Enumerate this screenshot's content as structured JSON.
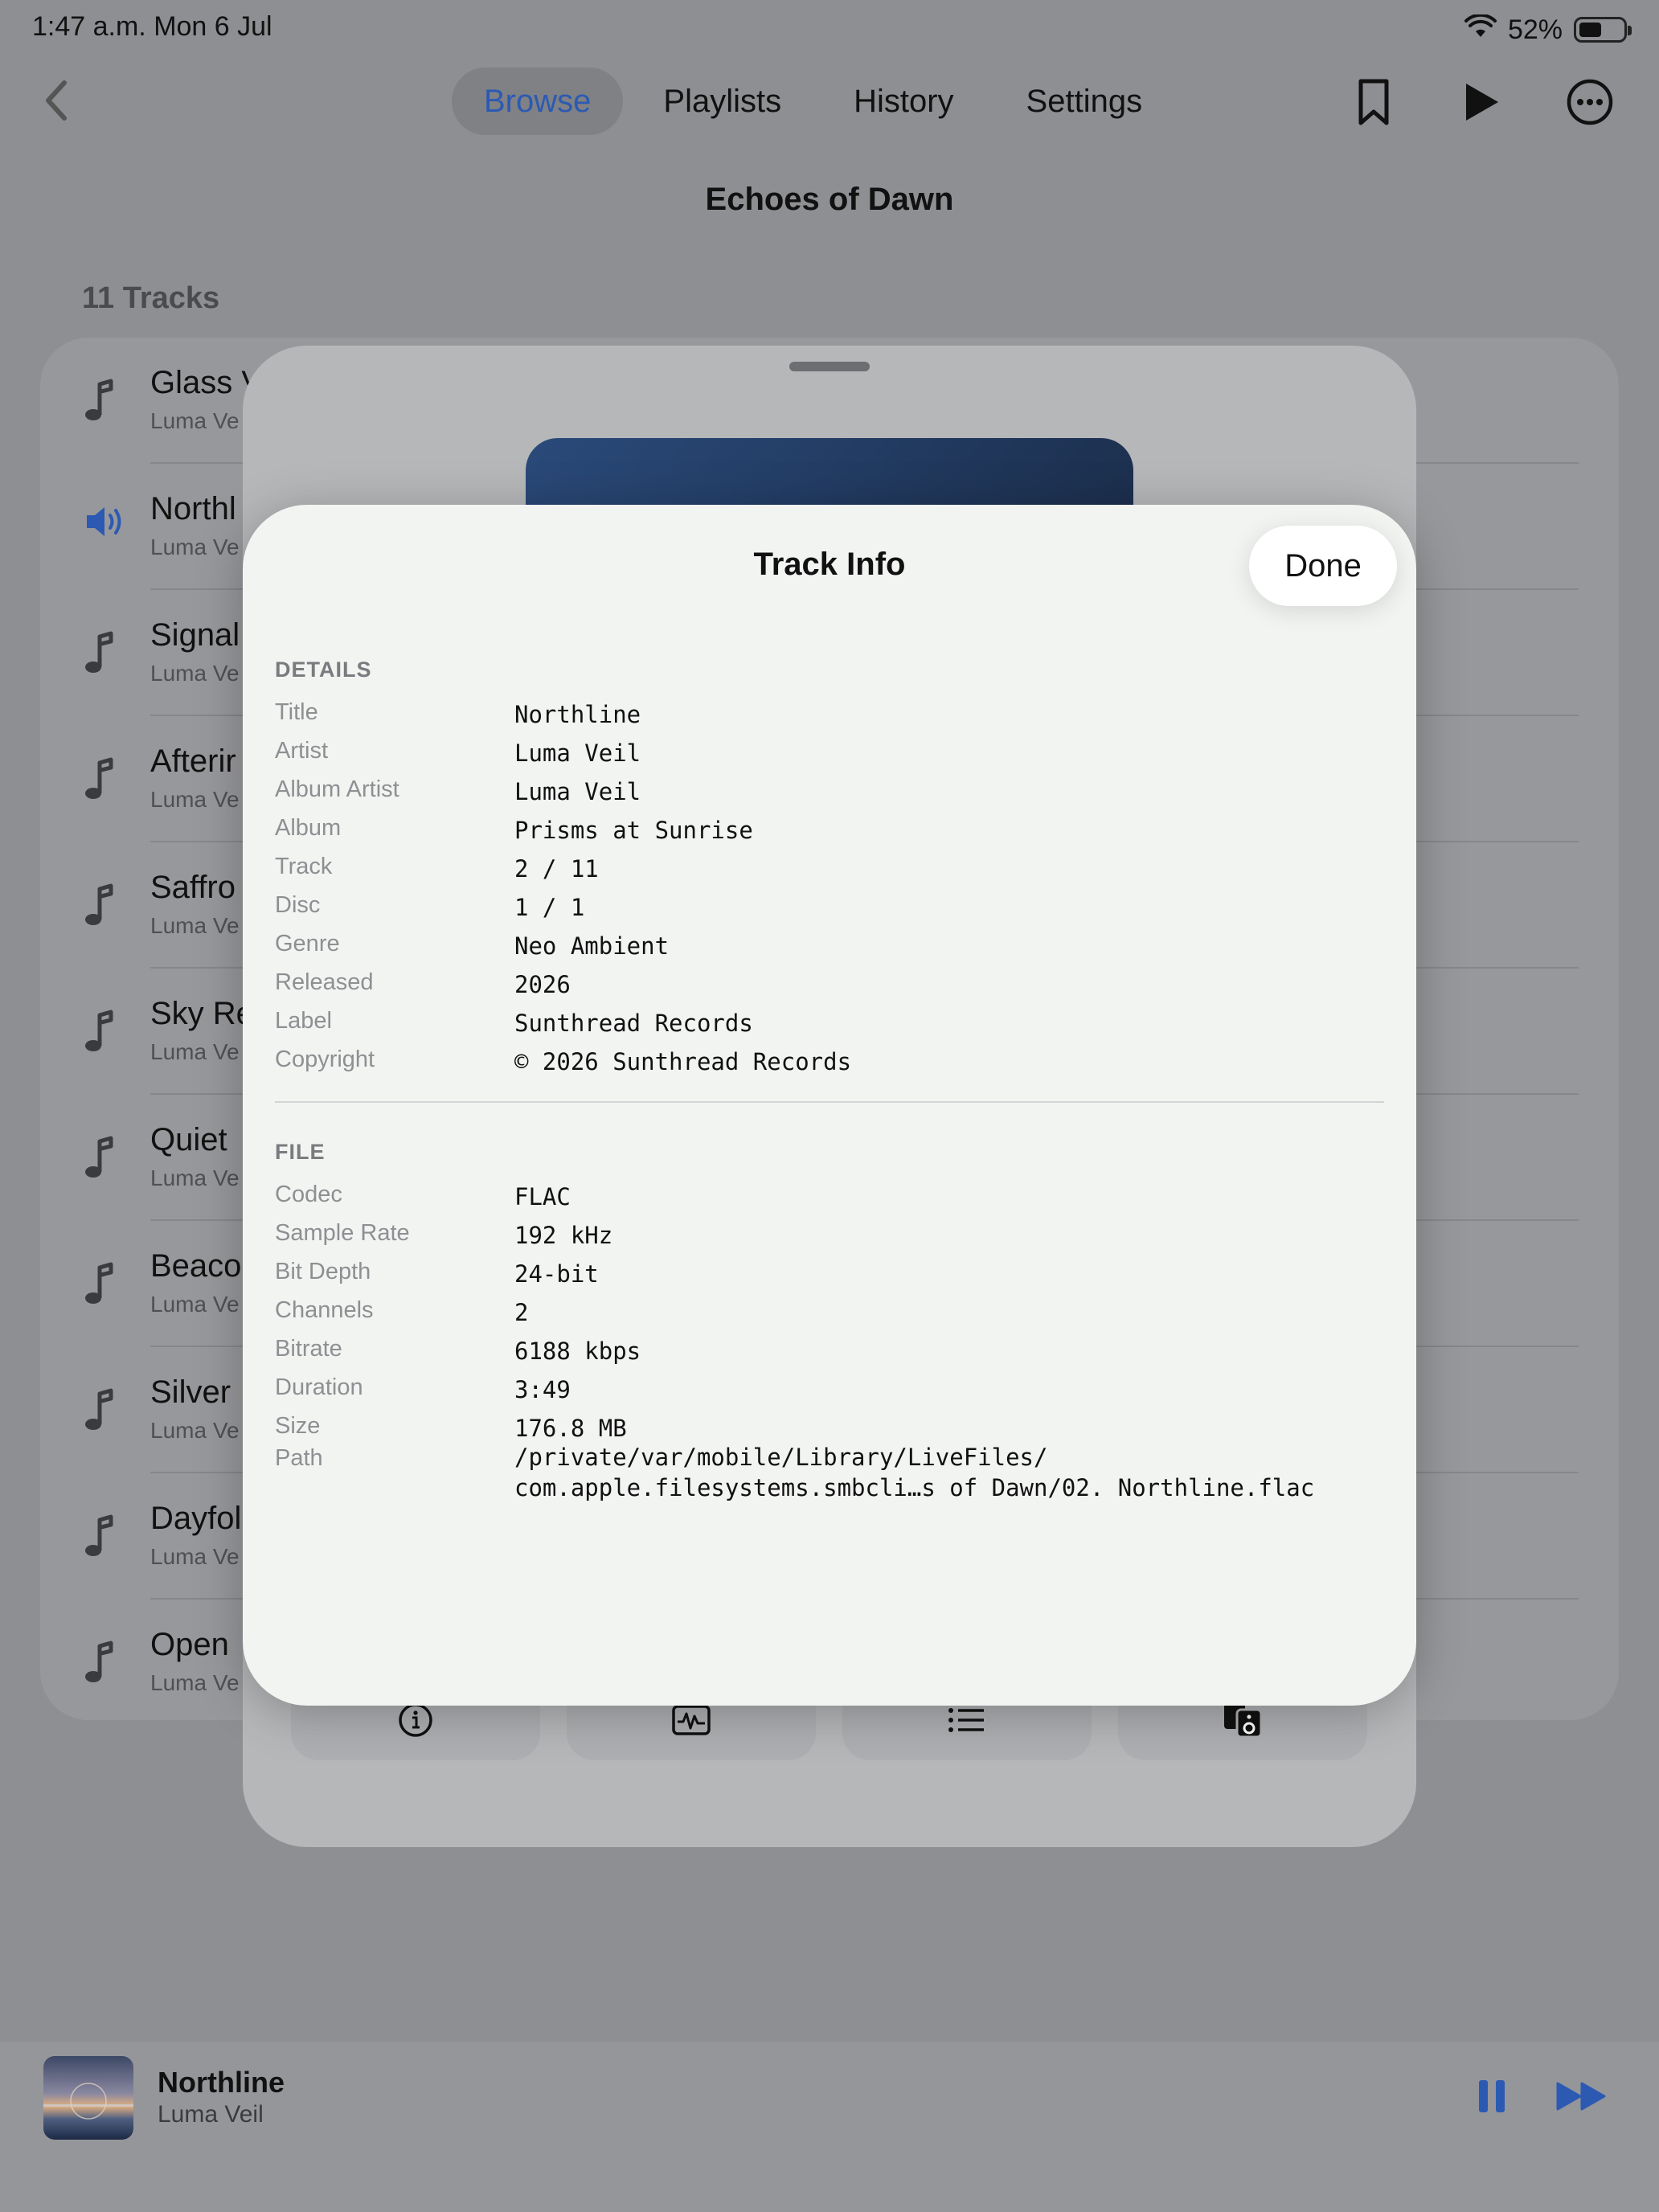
{
  "status_bar": {
    "time": "1:47 a.m.   Mon 6 Jul",
    "battery_pct": "52%",
    "battery_level": 0.52
  },
  "nav": {
    "tabs": [
      {
        "label": "Browse",
        "active": true
      },
      {
        "label": "Playlists",
        "active": false
      },
      {
        "label": "History",
        "active": false
      },
      {
        "label": "Settings",
        "active": false
      }
    ]
  },
  "album": {
    "title": "Echoes of Dawn",
    "track_count": "11 Tracks"
  },
  "tracks": [
    {
      "title": "Glass V",
      "artist": "Luma Ve",
      "icon": "music-note-icon"
    },
    {
      "title": "Northl",
      "artist": "Luma Ve",
      "icon": "speaker-icon"
    },
    {
      "title": "Signal",
      "artist": "Luma Ve",
      "icon": "music-note-icon"
    },
    {
      "title": "Afterir",
      "artist": "Luma Ve",
      "icon": "music-note-icon"
    },
    {
      "title": "Saffro",
      "artist": "Luma Ve",
      "icon": "music-note-icon"
    },
    {
      "title": "Sky Re",
      "artist": "Luma Ve",
      "icon": "music-note-icon"
    },
    {
      "title": "Quiet",
      "artist": "Luma Ve",
      "icon": "music-note-icon"
    },
    {
      "title": "Beaco",
      "artist": "Luma Ve",
      "icon": "music-note-icon"
    },
    {
      "title": "Silver",
      "artist": "Luma Ve",
      "icon": "music-note-icon"
    },
    {
      "title": "Dayfol",
      "artist": "Luma Ve",
      "icon": "music-note-icon"
    },
    {
      "title": "Open",
      "artist": "Luma Ve",
      "icon": "music-note-icon"
    }
  ],
  "sheet": {
    "title": "Track Info",
    "done_label": "Done",
    "details_header": "DETAILS",
    "details": [
      {
        "label": "Title",
        "value": "Northline"
      },
      {
        "label": "Artist",
        "value": "Luma Veil"
      },
      {
        "label": "Album Artist",
        "value": "Luma Veil"
      },
      {
        "label": "Album",
        "value": "Prisms at Sunrise"
      },
      {
        "label": "Track",
        "value": "2 / 11"
      },
      {
        "label": "Disc",
        "value": "1 / 1"
      },
      {
        "label": "Genre",
        "value": "Neo Ambient"
      },
      {
        "label": "Released",
        "value": "2026"
      },
      {
        "label": "Label",
        "value": "Sunthread Records"
      },
      {
        "label": "Copyright",
        "value": "© 2026 Sunthread Records"
      }
    ],
    "file_header": "FILE",
    "file": [
      {
        "label": "Codec",
        "value": "FLAC"
      },
      {
        "label": "Sample Rate",
        "value": "192 kHz"
      },
      {
        "label": "Bit Depth",
        "value": "24-bit"
      },
      {
        "label": "Channels",
        "value": "2"
      },
      {
        "label": "Bitrate",
        "value": "6188 kbps"
      },
      {
        "label": "Duration",
        "value": "3:49"
      },
      {
        "label": "Size",
        "value": "176.8 MB"
      }
    ],
    "path": {
      "label": "Path",
      "line1": "/private/var/mobile/Library/LiveFiles/",
      "line2": "com.apple.filesystems.smbcli…s of Dawn/02. Northline.flac"
    }
  },
  "now_playing": {
    "title": "Northline",
    "artist": "Luma Veil"
  },
  "colors": {
    "accent": "#2c5ab3",
    "background": "#8e8f92",
    "sheet": "#f2f4f2"
  }
}
